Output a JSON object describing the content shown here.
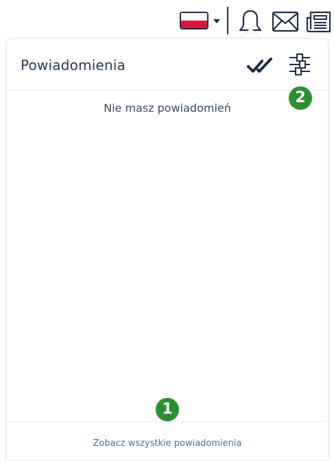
{
  "topbar": {
    "language": "pl",
    "icons": [
      "flag-pl-icon",
      "caret-down-icon",
      "bell-icon",
      "envelope-icon",
      "newspaper-icon"
    ]
  },
  "panel": {
    "title": "Powiadomienia",
    "empty_message": "Nie masz powiadomień",
    "see_all_label": "Zobacz wszystkie powiadomienia",
    "actions": [
      "double-check-icon",
      "sliders-icon"
    ]
  },
  "badges": {
    "one": "1",
    "two": "2"
  },
  "colors": {
    "text_dark": "#2b3a55",
    "link": "#4a6fa5",
    "badge_green": "#2a8f2e",
    "flag_red": "#dc143c",
    "icon_dark": "#1d2d45"
  }
}
